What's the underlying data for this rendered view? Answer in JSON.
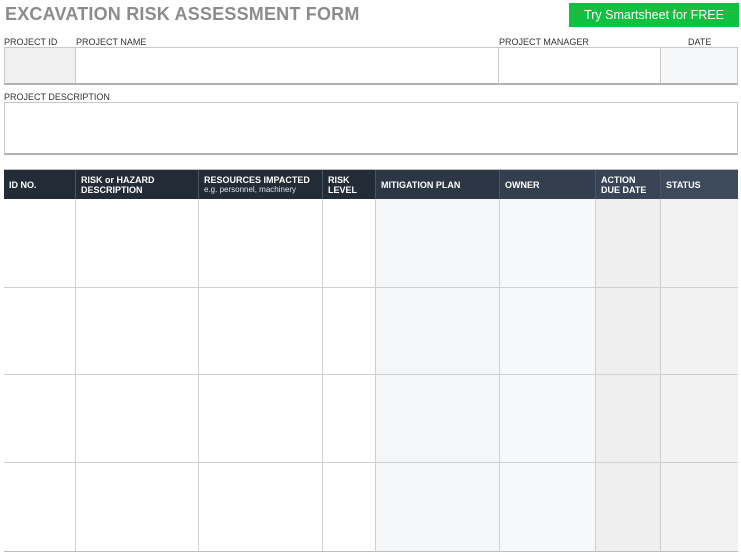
{
  "header": {
    "title": "EXCAVATION RISK ASSESSMENT FORM",
    "cta_label": "Try Smartsheet for FREE"
  },
  "project_info": {
    "project_id_label": "PROJECT ID",
    "project_name_label": "PROJECT NAME",
    "project_manager_label": "PROJECT MANAGER",
    "date_label": "DATE",
    "project_id_value": "",
    "project_name_value": "",
    "project_manager_value": "",
    "date_value": "",
    "description_label": "PROJECT DESCRIPTION",
    "description_value": ""
  },
  "table": {
    "columns": [
      {
        "line1": "ID NO.",
        "line2": "",
        "sub": ""
      },
      {
        "line1": "RISK or HAZARD",
        "line2": "DESCRIPTION",
        "sub": ""
      },
      {
        "line1": "RESOURCES IMPACTED",
        "line2": "",
        "sub": "e.g. personnel, machinery"
      },
      {
        "line1": "RISK",
        "line2": "LEVEL",
        "sub": ""
      },
      {
        "line1": "MITIGATION PLAN",
        "line2": "",
        "sub": ""
      },
      {
        "line1": "OWNER",
        "line2": "",
        "sub": ""
      },
      {
        "line1": "ACTION",
        "line2": "DUE DATE",
        "sub": ""
      },
      {
        "line1": "STATUS",
        "line2": "",
        "sub": ""
      }
    ],
    "rows": [
      [
        "",
        "",
        "",
        "",
        "",
        "",
        "",
        ""
      ],
      [
        "",
        "",
        "",
        "",
        "",
        "",
        "",
        ""
      ],
      [
        "",
        "",
        "",
        "",
        "",
        "",
        "",
        ""
      ],
      [
        "",
        "",
        "",
        "",
        "",
        "",
        "",
        ""
      ]
    ]
  },
  "colors": {
    "header_dark": "#222b36",
    "header_mid": "#3d4a5c",
    "cta_green": "#10c041"
  }
}
